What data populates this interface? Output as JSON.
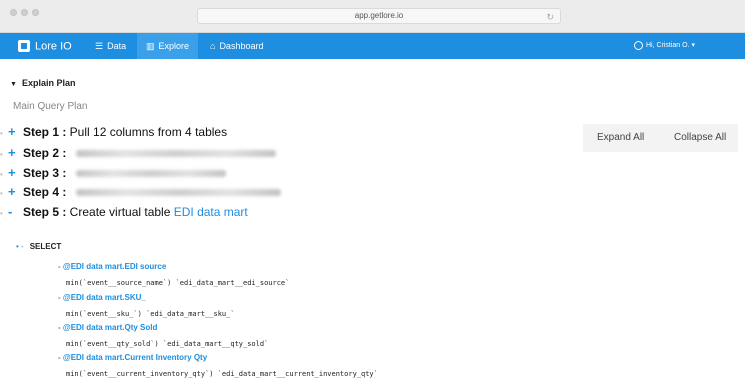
{
  "browser": {
    "url": "app.getlore.io"
  },
  "nav": {
    "logo_label": "Lore IO",
    "items": [
      {
        "icon": "database-icon",
        "label": "Data"
      },
      {
        "icon": "chart-icon",
        "label": "Explore"
      },
      {
        "icon": "home-icon",
        "label": "Dashboard"
      }
    ],
    "user_label": "Hi, Cristian O. ▾",
    "colors": {
      "bar": "#1e8ee0",
      "active": "#3aa0ea"
    }
  },
  "explain": {
    "title": "Explain Plan",
    "subtitle": "Main Query Plan",
    "expand_all": "Expand All",
    "collapse_all": "Collapse All",
    "steps": [
      {
        "toggle": "+",
        "label": "Step 1 :",
        "text": " Pull 12 columns from 4 tables"
      },
      {
        "toggle": "+",
        "label": "Step 2 :"
      },
      {
        "toggle": "+",
        "label": "Step 3 :"
      },
      {
        "toggle": "+",
        "label": "Step 4 :"
      },
      {
        "toggle": "-",
        "label": "Step 5 :",
        "text": " Create virtual table ",
        "link": "EDI data mart"
      }
    ],
    "select": {
      "marks": "•  -",
      "keyword": "SELECT"
    },
    "fields": [
      {
        "name": "- @EDI data mart.EDI source",
        "expr": "min(`event__source_name`) `edi_data_mart__edi_source`"
      },
      {
        "name": "- @EDI data mart.SKU_",
        "expr": "min(`event__sku_`) `edi_data_mart__sku_`"
      },
      {
        "name": "- @EDI data mart.Qty Sold",
        "expr": "min(`event__qty_sold`) `edi_data_mart__qty_sold`"
      },
      {
        "name": "- @EDI data mart.Current Inventory Qty",
        "expr": "min(`event__current_inventory_qty`) `edi_data_mart__current_inventory_qty`"
      }
    ]
  }
}
